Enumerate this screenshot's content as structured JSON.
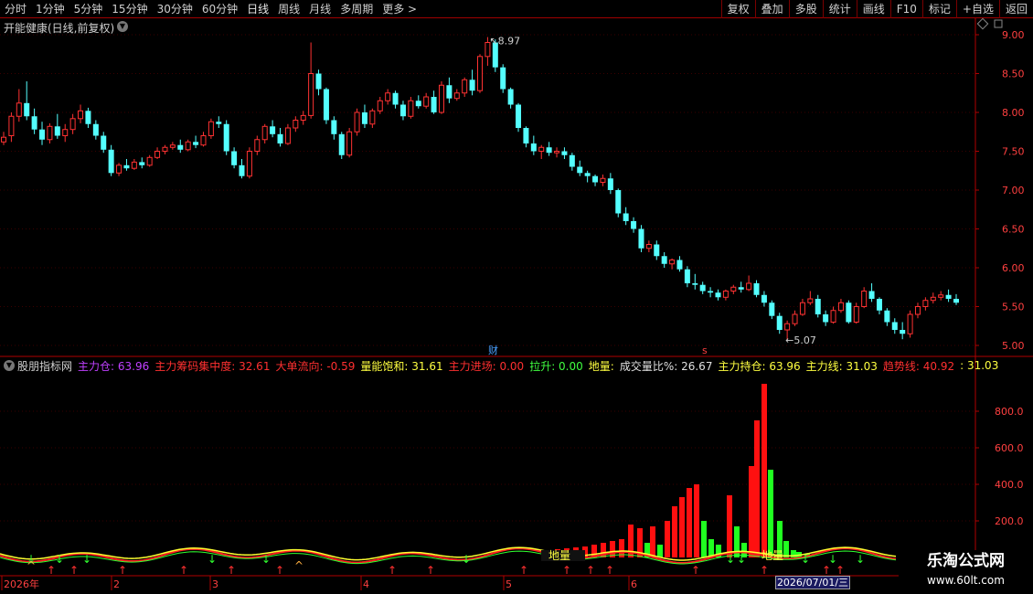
{
  "toolbar": {
    "periods": [
      "分时",
      "1分钟",
      "5分钟",
      "15分钟",
      "30分钟",
      "60分钟",
      "日线",
      "周线",
      "月线",
      "多周期",
      "更多 >"
    ],
    "active_period": "日线",
    "right_buttons": [
      "复权",
      "叠加",
      "多股",
      "统计",
      "画线",
      "F10",
      "标记",
      "+自选",
      "返回"
    ]
  },
  "stock": {
    "title": "开能健康(日线,前复权)"
  },
  "price_axis": {
    "labels": [
      "9.00",
      "8.50",
      "8.00",
      "7.50",
      "7.00",
      "6.50",
      "6.00",
      "5.50",
      "5.00"
    ]
  },
  "volume_axis": {
    "labels": [
      "800.0",
      "600.0",
      "400.0",
      "200.0"
    ]
  },
  "annotations": {
    "high": "8.97",
    "low": "5.07",
    "marker_cai": "财",
    "marker_s": "s"
  },
  "indicator": {
    "name": "股朋指标网",
    "items": [
      {
        "label": "主力仓:",
        "value": "63.96",
        "color": "#c040ff"
      },
      {
        "label": "主力筹码集中度:",
        "value": "32.61",
        "color": "#ff3030"
      },
      {
        "label": "大单流向:",
        "value": "-0.59",
        "color": "#ff3030"
      },
      {
        "label": "量能饱和:",
        "value": "31.61",
        "color": "#ffff40"
      },
      {
        "label": "主力进场:",
        "value": "0.00",
        "color": "#ff3030"
      },
      {
        "label": "拉升:",
        "value": "0.00",
        "color": "#40ff40"
      },
      {
        "label": "地量:",
        "value": "",
        "color": "#ffff40"
      },
      {
        "label": "成交量比%:",
        "value": "26.67",
        "color": "#e0e0e0"
      },
      {
        "label": "主力持仓:",
        "value": "63.96",
        "color": "#ffff40"
      },
      {
        "label": "主力线:",
        "value": "31.03",
        "color": "#ffff40"
      },
      {
        "label": "趋势线:",
        "value": "40.92",
        "color": "#ff3030"
      },
      {
        "label": ":",
        "value": "31.03",
        "color": "#ffff40"
      }
    ]
  },
  "dimian_labels": [
    "地量",
    "地量"
  ],
  "time_axis": {
    "labels": [
      "2026年",
      "2",
      "3",
      "4",
      "5",
      "6"
    ],
    "cursor_date": "2026/07/01/三"
  },
  "watermark": {
    "line1": "乐淘公式网",
    "line2": "www.60lt.com"
  },
  "chart_data": {
    "type": "candlestick",
    "price_ylim": [
      4.95,
      9.15
    ],
    "candles": [
      [
        7.62,
        7.75,
        7.68,
        7.58
      ],
      [
        7.7,
        8.0,
        7.95,
        7.62
      ],
      [
        7.95,
        8.3,
        8.12,
        7.88
      ],
      [
        8.12,
        8.4,
        7.95,
        7.9
      ],
      [
        7.95,
        8.05,
        7.78,
        7.72
      ],
      [
        7.78,
        7.88,
        7.65,
        7.58
      ],
      [
        7.65,
        7.86,
        7.82,
        7.6
      ],
      [
        7.82,
        7.98,
        7.7,
        7.66
      ],
      [
        7.7,
        7.85,
        7.78,
        7.62
      ],
      [
        7.78,
        7.98,
        7.92,
        7.72
      ],
      [
        7.92,
        8.1,
        8.02,
        7.86
      ],
      [
        8.02,
        8.06,
        7.85,
        7.8
      ],
      [
        7.85,
        7.9,
        7.7,
        7.65
      ],
      [
        7.7,
        7.75,
        7.52,
        7.48
      ],
      [
        7.52,
        7.58,
        7.22,
        7.18
      ],
      [
        7.22,
        7.35,
        7.32,
        7.18
      ],
      [
        7.32,
        7.4,
        7.28,
        7.25
      ],
      [
        7.28,
        7.4,
        7.36,
        7.26
      ],
      [
        7.36,
        7.42,
        7.32,
        7.28
      ],
      [
        7.32,
        7.45,
        7.42,
        7.3
      ],
      [
        7.42,
        7.55,
        7.5,
        7.4
      ],
      [
        7.5,
        7.58,
        7.55,
        7.46
      ],
      [
        7.55,
        7.62,
        7.58,
        7.52
      ],
      [
        7.58,
        7.65,
        7.52,
        7.48
      ],
      [
        7.52,
        7.65,
        7.62,
        7.5
      ],
      [
        7.62,
        7.7,
        7.58,
        7.54
      ],
      [
        7.58,
        7.75,
        7.7,
        7.56
      ],
      [
        7.7,
        7.92,
        7.88,
        7.66
      ],
      [
        7.88,
        7.95,
        7.85,
        7.8
      ],
      [
        7.85,
        7.9,
        7.5,
        7.45
      ],
      [
        7.5,
        7.55,
        7.32,
        7.28
      ],
      [
        7.32,
        7.4,
        7.18,
        7.15
      ],
      [
        7.18,
        7.55,
        7.5,
        7.15
      ],
      [
        7.5,
        7.7,
        7.65,
        7.45
      ],
      [
        7.65,
        7.85,
        7.82,
        7.6
      ],
      [
        7.82,
        7.9,
        7.72,
        7.68
      ],
      [
        7.72,
        7.8,
        7.6,
        7.56
      ],
      [
        7.6,
        7.85,
        7.8,
        7.58
      ],
      [
        7.8,
        7.95,
        7.9,
        7.75
      ],
      [
        7.9,
        8.02,
        7.96,
        7.84
      ],
      [
        7.96,
        8.9,
        8.5,
        7.92
      ],
      [
        8.5,
        8.55,
        8.3,
        8.22
      ],
      [
        8.3,
        8.32,
        7.9,
        7.85
      ],
      [
        7.9,
        7.95,
        7.72,
        7.65
      ],
      [
        7.72,
        7.75,
        7.45,
        7.4
      ],
      [
        7.45,
        7.8,
        7.75,
        7.42
      ],
      [
        7.75,
        8.05,
        8.0,
        7.7
      ],
      [
        8.0,
        8.1,
        7.85,
        7.8
      ],
      [
        7.85,
        8.05,
        8.02,
        7.8
      ],
      [
        8.02,
        8.2,
        8.15,
        7.98
      ],
      [
        8.15,
        8.3,
        8.25,
        8.1
      ],
      [
        8.25,
        8.28,
        8.1,
        8.05
      ],
      [
        8.1,
        8.15,
        7.95,
        7.9
      ],
      [
        7.95,
        8.2,
        8.15,
        7.92
      ],
      [
        8.15,
        8.22,
        8.08,
        8.05
      ],
      [
        8.08,
        8.25,
        8.2,
        8.05
      ],
      [
        8.2,
        8.28,
        8.0,
        7.98
      ],
      [
        8.0,
        8.4,
        8.35,
        7.98
      ],
      [
        8.35,
        8.45,
        8.18,
        8.12
      ],
      [
        8.18,
        8.3,
        8.25,
        8.15
      ],
      [
        8.25,
        8.45,
        8.42,
        8.2
      ],
      [
        8.42,
        8.55,
        8.28,
        8.22
      ],
      [
        8.28,
        8.75,
        8.72,
        8.25
      ],
      [
        8.72,
        8.97,
        8.9,
        8.6
      ],
      [
        8.9,
        8.94,
        8.58,
        8.52
      ],
      [
        8.58,
        8.62,
        8.3,
        8.25
      ],
      [
        8.3,
        8.32,
        8.1,
        8.05
      ],
      [
        8.1,
        8.12,
        7.8,
        7.75
      ],
      [
        7.8,
        7.82,
        7.6,
        7.55
      ],
      [
        7.6,
        7.7,
        7.5,
        7.45
      ],
      [
        7.5,
        7.58,
        7.55,
        7.4
      ],
      [
        7.55,
        7.62,
        7.48,
        7.44
      ],
      [
        7.48,
        7.55,
        7.5,
        7.42
      ],
      [
        7.5,
        7.55,
        7.45,
        7.4
      ],
      [
        7.45,
        7.48,
        7.3,
        7.25
      ],
      [
        7.3,
        7.38,
        7.22,
        7.18
      ],
      [
        7.22,
        7.25,
        7.18,
        7.1
      ],
      [
        7.18,
        7.2,
        7.1,
        7.05
      ],
      [
        7.1,
        7.2,
        7.15,
        7.05
      ],
      [
        7.15,
        7.22,
        7.0,
        6.95
      ],
      [
        7.0,
        7.02,
        6.7,
        6.65
      ],
      [
        6.7,
        6.78,
        6.6,
        6.55
      ],
      [
        6.6,
        6.65,
        6.5,
        6.45
      ],
      [
        6.5,
        6.55,
        6.25,
        6.2
      ],
      [
        6.25,
        6.35,
        6.3,
        6.2
      ],
      [
        6.3,
        6.35,
        6.15,
        6.1
      ],
      [
        6.15,
        6.2,
        6.05,
        6.0
      ],
      [
        6.05,
        6.12,
        6.1,
        5.98
      ],
      [
        6.1,
        6.15,
        5.98,
        5.95
      ],
      [
        5.98,
        6.02,
        5.8,
        5.75
      ],
      [
        5.8,
        5.92,
        5.78,
        5.72
      ],
      [
        5.78,
        5.82,
        5.7,
        5.66
      ],
      [
        5.7,
        5.75,
        5.68,
        5.62
      ],
      [
        5.68,
        5.72,
        5.62,
        5.58
      ],
      [
        5.62,
        5.72,
        5.7,
        5.58
      ],
      [
        5.7,
        5.78,
        5.75,
        5.66
      ],
      [
        5.75,
        5.82,
        5.72,
        5.68
      ],
      [
        5.72,
        5.9,
        5.8,
        5.7
      ],
      [
        5.8,
        5.84,
        5.65,
        5.62
      ],
      [
        5.65,
        5.7,
        5.55,
        5.5
      ],
      [
        5.55,
        5.58,
        5.38,
        5.34
      ],
      [
        5.38,
        5.42,
        5.2,
        5.15
      ],
      [
        5.2,
        5.32,
        5.28,
        5.07
      ],
      [
        5.28,
        5.45,
        5.4,
        5.25
      ],
      [
        5.4,
        5.6,
        5.55,
        5.38
      ],
      [
        5.55,
        5.7,
        5.6,
        5.52
      ],
      [
        5.6,
        5.65,
        5.4,
        5.36
      ],
      [
        5.4,
        5.45,
        5.3,
        5.25
      ],
      [
        5.3,
        5.5,
        5.45,
        5.28
      ],
      [
        5.45,
        5.6,
        5.55,
        5.42
      ],
      [
        5.55,
        5.58,
        5.3,
        5.28
      ],
      [
        5.3,
        5.55,
        5.5,
        5.28
      ],
      [
        5.5,
        5.75,
        5.7,
        5.48
      ],
      [
        5.7,
        5.8,
        5.6,
        5.56
      ],
      [
        5.6,
        5.62,
        5.45,
        5.4
      ],
      [
        5.45,
        5.48,
        5.3,
        5.25
      ],
      [
        5.3,
        5.35,
        5.2,
        5.15
      ],
      [
        5.2,
        5.3,
        5.15,
        5.08
      ],
      [
        5.15,
        5.45,
        5.4,
        5.1
      ],
      [
        5.4,
        5.55,
        5.5,
        5.35
      ],
      [
        5.5,
        5.62,
        5.58,
        5.45
      ],
      [
        5.58,
        5.68,
        5.62,
        5.54
      ],
      [
        5.62,
        5.7,
        5.65,
        5.58
      ],
      [
        5.65,
        5.72,
        5.6,
        5.56
      ],
      [
        5.6,
        5.66,
        5.55,
        5.52
      ]
    ],
    "volume_ylim": [
      0,
      1000
    ],
    "volume_bars": [
      [
        597,
        40,
        1
      ],
      [
        607,
        45,
        1
      ],
      [
        617,
        50,
        1
      ],
      [
        627,
        55,
        1
      ],
      [
        637,
        60,
        1
      ],
      [
        647,
        70,
        1
      ],
      [
        657,
        80,
        1
      ],
      [
        667,
        90,
        1
      ],
      [
        677,
        100,
        1
      ],
      [
        687,
        180,
        1
      ],
      [
        697,
        160,
        1
      ],
      [
        705,
        80,
        0
      ],
      [
        711,
        170,
        1
      ],
      [
        719,
        70,
        0
      ],
      [
        727,
        200,
        1
      ],
      [
        735,
        280,
        1
      ],
      [
        743,
        330,
        1
      ],
      [
        751,
        380,
        1
      ],
      [
        759,
        400,
        1
      ],
      [
        767,
        200,
        0
      ],
      [
        775,
        100,
        0
      ],
      [
        783,
        70,
        0
      ],
      [
        795,
        340,
        1
      ],
      [
        803,
        170,
        0
      ],
      [
        811,
        80,
        0
      ],
      [
        819,
        500,
        1
      ],
      [
        825,
        750,
        1
      ],
      [
        833,
        950,
        1
      ],
      [
        840,
        480,
        0
      ],
      [
        850,
        200,
        0
      ],
      [
        857,
        90,
        0
      ],
      [
        865,
        40,
        0
      ],
      [
        871,
        30,
        0
      ],
      [
        880,
        20,
        0
      ]
    ]
  }
}
